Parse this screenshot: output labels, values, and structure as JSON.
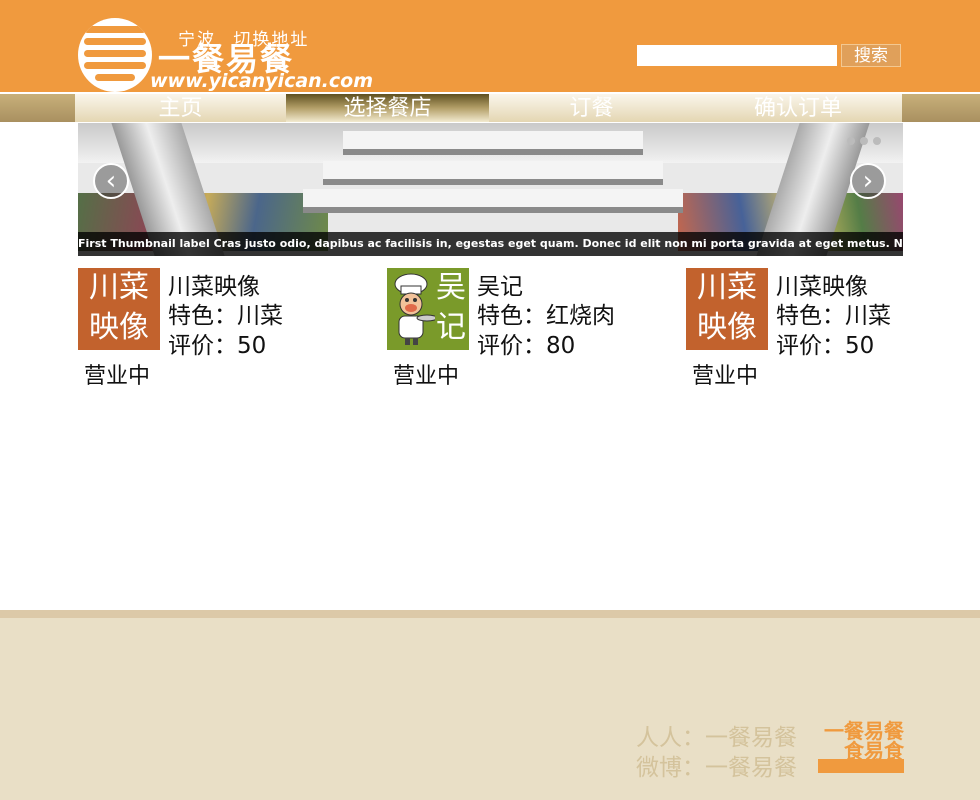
{
  "header": {
    "city": "宁波",
    "switch_address": "切换地址",
    "logo_name": "一餐易餐",
    "logo_url": "www.yicanyican.com",
    "search_placeholder": "",
    "search_button": "搜索"
  },
  "nav": {
    "items": [
      {
        "label": "主页"
      },
      {
        "label": "选择餐店"
      },
      {
        "label": "订餐"
      },
      {
        "label": "确认订单"
      }
    ],
    "active_index": 1
  },
  "carousel": {
    "caption": "First Thumbnail label Cras justo odio, dapibus ac facilisis in, egestas eget quam. Donec id elit non mi porta gravida at eget metus. Nullam id dolor id",
    "prev_icon": "‹",
    "next_icon": "›",
    "slide_count": 3
  },
  "restaurants": [
    {
      "thumb_line1": "川菜",
      "thumb_line2": "映像",
      "name": "川菜映像",
      "specialty": "特色：川菜",
      "rating": "评价：50",
      "status": "营业中",
      "thumb_color": "#c2622d"
    },
    {
      "thumb_line1": "吴",
      "thumb_line2": "记",
      "name": "吴记",
      "specialty": "特色：红烧肉",
      "rating": "评价：80",
      "status": "营业中",
      "thumb_color": "#7a9a2a"
    },
    {
      "thumb_line1": "川菜",
      "thumb_line2": "映像",
      "name": "川菜映像",
      "specialty": "特色：川菜",
      "rating": "评价：50",
      "status": "营业中",
      "thumb_color": "#c2622d"
    }
  ],
  "footer": {
    "renren": "人人：一餐易餐",
    "weibo": "微博：一餐易餐",
    "logo_text": "一餐易餐 食易食"
  },
  "colors": {
    "brand_orange": "#f09a3e",
    "nav_gold": "#b39f68",
    "footer_bg": "#e9dfc6"
  }
}
